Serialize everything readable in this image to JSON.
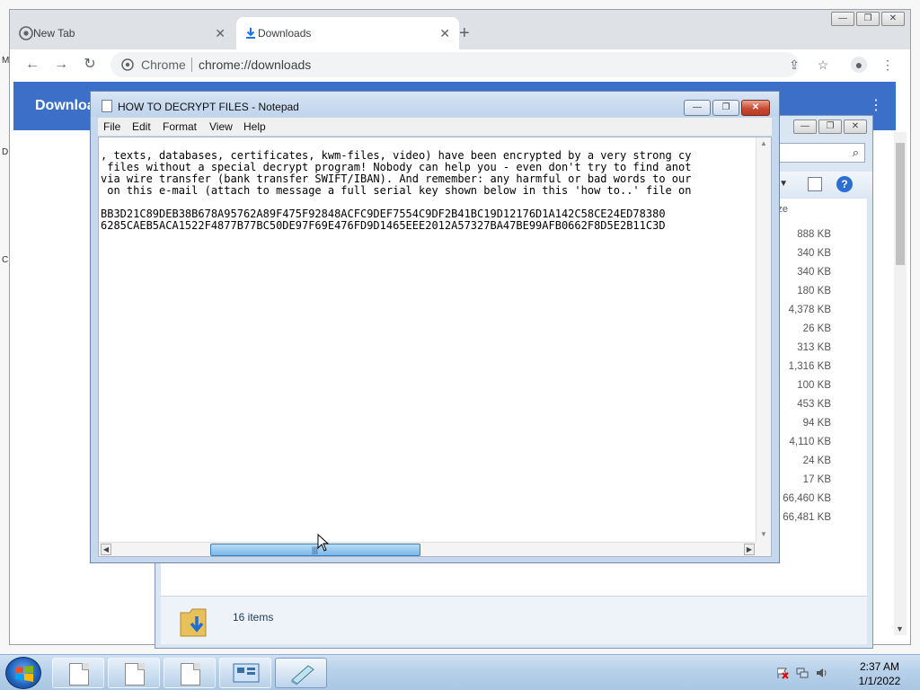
{
  "chrome": {
    "tabs": [
      {
        "label": "New Tab",
        "icon": "chrome-icon",
        "close": "✕"
      },
      {
        "label": "Downloads",
        "icon": "download-icon",
        "close": "✕"
      }
    ],
    "new_tab": "+",
    "omnibox": {
      "site_name": "Chrome",
      "url": "chrome://downloads"
    },
    "page_title": "Downloa",
    "menu_glyph": "⋮"
  },
  "explorer": {
    "size_header": "ze",
    "sizes": [
      "888 KB",
      "340 KB",
      "340 KB",
      "180 KB",
      "4,378 KB",
      "26 KB",
      "313 KB",
      "1,316 KB",
      "100 KB",
      "453 KB",
      "94 KB",
      "4,110 KB",
      "24 KB",
      "17 KB",
      "66,460 KB",
      "66,481 KB"
    ],
    "status": "16 items"
  },
  "notepad": {
    "title": "HOW TO DECRYPT FILES - Notepad",
    "menu": [
      "File",
      "Edit",
      "Format",
      "View",
      "Help"
    ],
    "lines": [
      ", texts, databases, certificates, kwm-files, video) have been encrypted by a very strong cy",
      " files without a special decrypt program! Nobody can help you - even don't try to find anot",
      "via wire transfer (bank transfer SWIFT/IBAN). And remember: any harmful or bad words to our",
      " on this e-mail (attach to message a full serial key shown below in this 'how to..' file on",
      "",
      "BB3D21C89DEB38B678A95762A89F475F92848ACFC9DEF7554C9DF2B41BC19D12176D1A142C58CE24ED78380",
      "6285CAEB5ACA1522F4877B77BC50DE97F69E476FD9D1465EEE2012A57327BA47BE99AFB0662F8D5E2B11C3D"
    ],
    "hscroll_position": 0.18
  },
  "taskbar": {
    "clock_time": "2:37 AM",
    "clock_date": "1/1/2022"
  },
  "desktop": {
    "edge_chars": [
      "M",
      "D",
      "C"
    ]
  },
  "colors": {
    "chrome_header": "#3c70c8",
    "notepad_frame": "#c6d8ee",
    "close_red": "#c74a31",
    "taskbar": "#b8d1ea"
  }
}
